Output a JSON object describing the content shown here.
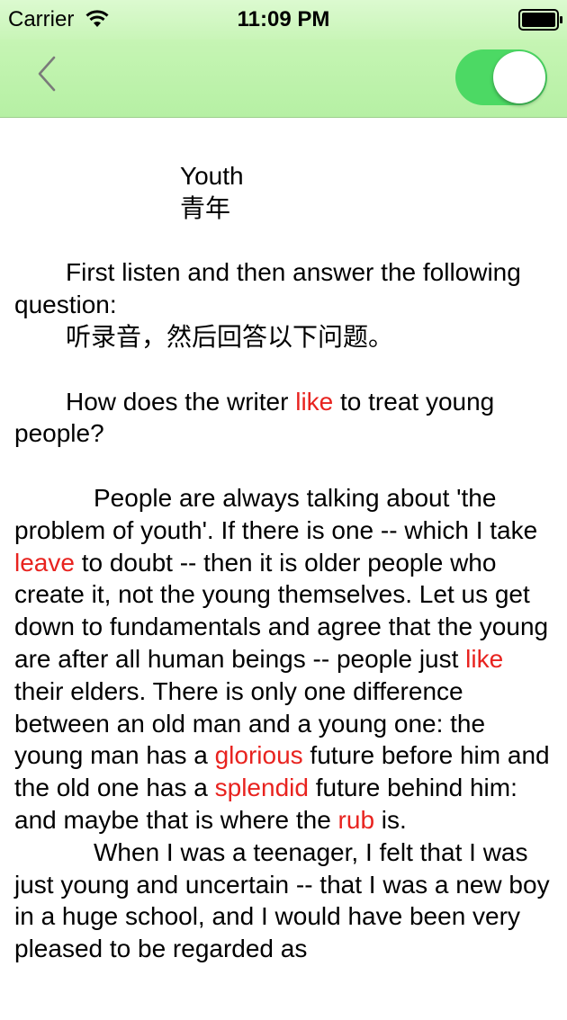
{
  "status_bar": {
    "carrier": "Carrier",
    "time": "11:09 PM"
  },
  "nav": {
    "back_icon": "chevron-left-icon",
    "toggle_on": true,
    "toggle_color": "#4cd964"
  },
  "article": {
    "title_en": "Youth",
    "title_cn": "青年",
    "instruction_en": "First listen and then answer the following question:",
    "instruction_cn": "听录音，然后回答以下问题。",
    "question": {
      "pre": "How does the writer ",
      "word": "like",
      "post": " to treat young people?"
    },
    "p1": {
      "t1": "People are always talking about 'the problem of youth'. If there is one -- which I take ",
      "w1": "leave",
      "t2": " to doubt -- then it is older people who create it, not the young themselves. Let us get down to fundamentals and agree that the young are after all human beings -- people just ",
      "w2": "like",
      "t3": " their elders. There is only one difference between an old man and a young one: the young man has a ",
      "w3": "glorious",
      "t4": " future before him and the old one has a ",
      "w4": "splendid",
      "t5": " future behind him: and maybe that is where the ",
      "w5": "rub",
      "t6": " is."
    },
    "p2": "When I was a teenager, I felt that I was just young and uncertain -- that I was a new boy in a huge school, and I would have been very pleased to be regarded as"
  },
  "highlight_color": "#e8231f"
}
